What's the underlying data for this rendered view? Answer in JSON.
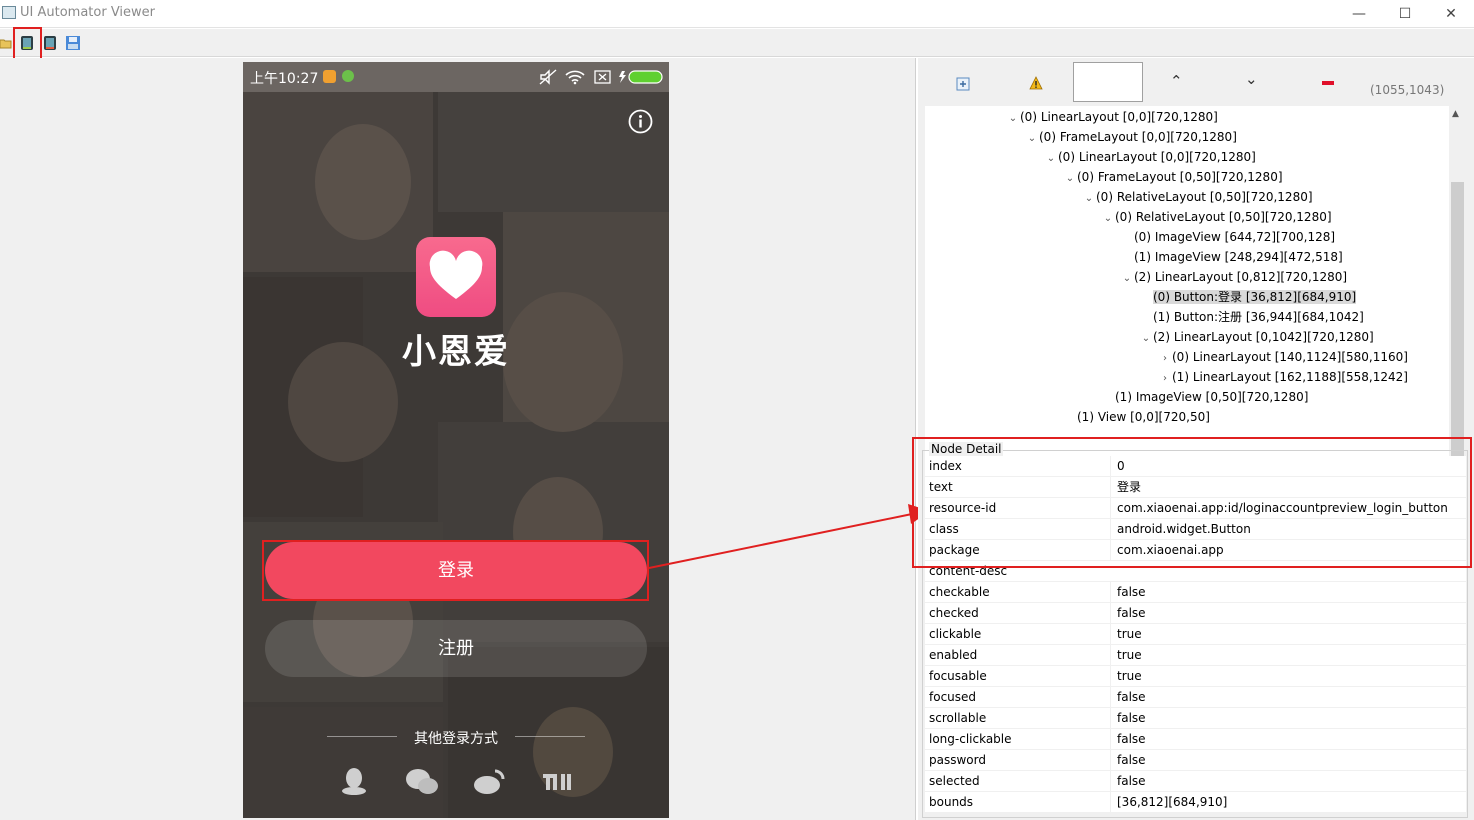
{
  "window": {
    "title": "UI Automator Viewer",
    "controls": {
      "minimize": "—",
      "maximize": "☐",
      "close": "✕"
    }
  },
  "toolbar": {
    "icons": [
      "open-folder-icon",
      "device-screenshot-icon",
      "device-screenshot-compressed-icon",
      "save-icon"
    ]
  },
  "device": {
    "status_time": "上午10:27",
    "app_name": "小恩爱",
    "login_button": "登录",
    "register_button": "注册",
    "other_login_label": "其他登录方式",
    "social_icons": [
      "qq-icon",
      "wechat-icon",
      "weibo-icon",
      "mi-icon"
    ]
  },
  "tree_toolbar": {
    "coords": "(1055,1043)"
  },
  "tree": [
    {
      "label": "(0) LinearLayout [0,0][720,1280]",
      "depth": 0,
      "state": "expanded",
      "selected": false
    },
    {
      "label": "(0) FrameLayout [0,0][720,1280]",
      "depth": 1,
      "state": "expanded",
      "selected": false
    },
    {
      "label": "(0) LinearLayout [0,0][720,1280]",
      "depth": 2,
      "state": "expanded",
      "selected": false
    },
    {
      "label": "(0) FrameLayout [0,50][720,1280]",
      "depth": 3,
      "state": "expanded",
      "selected": false
    },
    {
      "label": "(0) RelativeLayout [0,50][720,1280]",
      "depth": 4,
      "state": "expanded",
      "selected": false
    },
    {
      "label": "(0) RelativeLayout [0,50][720,1280]",
      "depth": 5,
      "state": "expanded",
      "selected": false
    },
    {
      "label": "(0) ImageView [644,72][700,128]",
      "depth": 6,
      "state": "leaf",
      "selected": false
    },
    {
      "label": "(1) ImageView [248,294][472,518]",
      "depth": 6,
      "state": "leaf",
      "selected": false
    },
    {
      "label": "(2) LinearLayout [0,812][720,1280]",
      "depth": 6,
      "state": "expanded",
      "selected": false
    },
    {
      "label": "(0) Button:登录 [36,812][684,910]",
      "depth": 7,
      "state": "leaf",
      "selected": true
    },
    {
      "label": "(1) Button:注册 [36,944][684,1042]",
      "depth": 7,
      "state": "leaf",
      "selected": false
    },
    {
      "label": "(2) LinearLayout [0,1042][720,1280]",
      "depth": 7,
      "state": "expanded",
      "selected": false
    },
    {
      "label": "(0) LinearLayout [140,1124][580,1160]",
      "depth": 8,
      "state": "collapsed",
      "selected": false
    },
    {
      "label": "(1) LinearLayout [162,1188][558,1242]",
      "depth": 8,
      "state": "collapsed",
      "selected": false
    },
    {
      "label": "(1) ImageView [0,50][720,1280]",
      "depth": 5,
      "state": "leaf",
      "selected": false
    },
    {
      "label": "(1) View [0,0][720,50]",
      "depth": 3,
      "state": "leaf",
      "selected": false
    }
  ],
  "node_detail": {
    "title": "Node Detail",
    "rows": [
      {
        "key": "index",
        "value": "0"
      },
      {
        "key": "text",
        "value": "登录"
      },
      {
        "key": "resource-id",
        "value": "com.xiaoenai.app:id/loginaccountpreview_login_button"
      },
      {
        "key": "class",
        "value": "android.widget.Button"
      },
      {
        "key": "package",
        "value": "com.xiaoenai.app"
      },
      {
        "key": "content-desc",
        "value": ""
      },
      {
        "key": "checkable",
        "value": "false"
      },
      {
        "key": "checked",
        "value": "false"
      },
      {
        "key": "clickable",
        "value": "true"
      },
      {
        "key": "enabled",
        "value": "true"
      },
      {
        "key": "focusable",
        "value": "true"
      },
      {
        "key": "focused",
        "value": "false"
      },
      {
        "key": "scrollable",
        "value": "false"
      },
      {
        "key": "long-clickable",
        "value": "false"
      },
      {
        "key": "password",
        "value": "false"
      },
      {
        "key": "selected",
        "value": "false"
      },
      {
        "key": "bounds",
        "value": "[36,812][684,910]"
      }
    ]
  },
  "colors": {
    "annotation_red": "#e02020",
    "login_button_bg": "#f2485f",
    "selection_bg": "#d9d9d9",
    "app_icon_pink": "#f45b8a"
  }
}
